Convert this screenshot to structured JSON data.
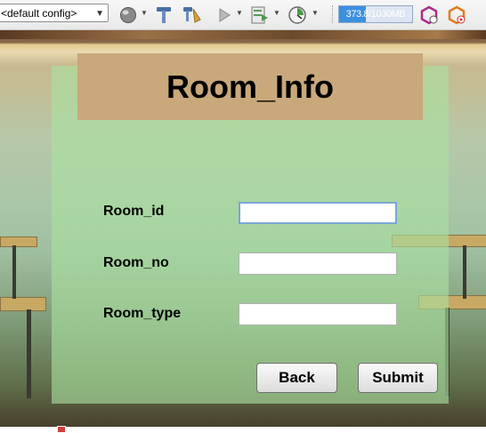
{
  "toolbar": {
    "config_select": {
      "value": "<default config>"
    },
    "memory": {
      "text": "373.8/1030MB",
      "used_mb": 373.8,
      "total_mb": 1030
    },
    "icons": [
      "globe-icon",
      "hammer-icon",
      "clean-build-icon",
      "run-icon",
      "debug-icon",
      "profile-icon",
      "gc-icon",
      "profiler-snapshot-icon"
    ]
  },
  "form": {
    "title": "Room_Info",
    "fields": [
      {
        "label": "Room_id",
        "value": ""
      },
      {
        "label": "Room_no",
        "value": ""
      },
      {
        "label": "Room_type",
        "value": ""
      }
    ],
    "back_label": "Back",
    "submit_label": "Submit"
  },
  "colors": {
    "title_bg": "#c9a87b",
    "panel_bg": "#aae1a0",
    "memory_fill": "#3d8fe0"
  }
}
